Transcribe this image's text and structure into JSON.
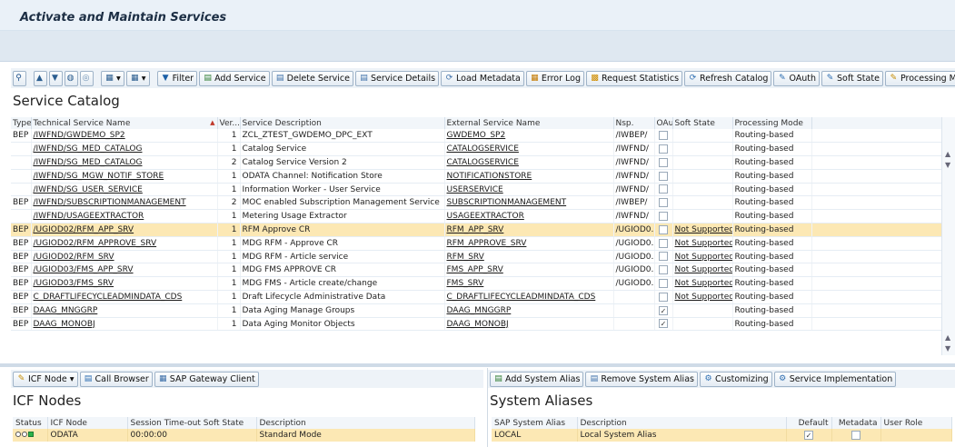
{
  "page": {
    "title": "Activate and Maintain Services"
  },
  "toolbar": {
    "filter": "Filter",
    "add_service": "Add Service",
    "delete_service": "Delete Service",
    "service_details": "Service Details",
    "load_metadata": "Load Metadata",
    "error_log": "Error Log",
    "request_statistics": "Request Statistics",
    "refresh_catalog": "Refresh Catalog",
    "oauth": "OAuth",
    "soft_state": "Soft State",
    "processing_mode": "Processing Mode"
  },
  "service_catalog": {
    "title": "Service Catalog",
    "columns": [
      "Type",
      "Technical Service Name",
      "Ver...",
      "Service Description",
      "External Service Name",
      "Nsp.",
      "OAut...",
      "Soft State",
      "Processing Mode"
    ],
    "rows": [
      {
        "type": "BEP",
        "tech": "/IWFND/GWDEMO_SP2",
        "ver": "1",
        "desc": "ZCL_ZTEST_GWDEMO_DPC_EXT",
        "ext": "GWDEMO_SP2",
        "nsp": "/IWBEP/",
        "oauth": false,
        "soft": "",
        "mode": "Routing-based",
        "selected": false
      },
      {
        "type": "",
        "tech": "/IWFND/SG_MED_CATALOG",
        "ver": "1",
        "desc": "Catalog Service",
        "ext": "CATALOGSERVICE",
        "nsp": "/IWFND/",
        "oauth": false,
        "soft": "",
        "mode": "Routing-based",
        "selected": false
      },
      {
        "type": "",
        "tech": "/IWFND/SG_MED_CATALOG",
        "ver": "2",
        "desc": "Catalog Service Version 2",
        "ext": "CATALOGSERVICE",
        "nsp": "/IWFND/",
        "oauth": false,
        "soft": "",
        "mode": "Routing-based",
        "selected": false
      },
      {
        "type": "",
        "tech": "/IWFND/SG_MGW_NOTIF_STORE",
        "ver": "1",
        "desc": "ODATA Channel: Notification Store",
        "ext": "NOTIFICATIONSTORE",
        "nsp": "/IWFND/",
        "oauth": false,
        "soft": "",
        "mode": "Routing-based",
        "selected": false
      },
      {
        "type": "",
        "tech": "/IWFND/SG_USER_SERVICE",
        "ver": "1",
        "desc": "Information Worker - User Service",
        "ext": "USERSERVICE",
        "nsp": "/IWFND/",
        "oauth": false,
        "soft": "",
        "mode": "Routing-based",
        "selected": false
      },
      {
        "type": "BEP",
        "tech": "/IWFND/SUBSCRIPTIONMANAGEMENT",
        "ver": "2",
        "desc": "MOC enabled Subscription Management Service",
        "ext": "SUBSCRIPTIONMANAGEMENT",
        "nsp": "/IWBEP/",
        "oauth": false,
        "soft": "",
        "mode": "Routing-based",
        "selected": false
      },
      {
        "type": "",
        "tech": "/IWFND/USAGEEXTRACTOR",
        "ver": "1",
        "desc": "Metering Usage Extractor",
        "ext": "USAGEEXTRACTOR",
        "nsp": "/IWFND/",
        "oauth": false,
        "soft": "",
        "mode": "Routing-based",
        "selected": false
      },
      {
        "type": "BEP",
        "tech": "/UGIOD02/RFM_APP_SRV",
        "ver": "1",
        "desc": "RFM Approve CR",
        "ext": "RFM_APP_SRV",
        "nsp": "/UGIOD0...",
        "oauth": false,
        "soft": "Not Supported",
        "mode": "Routing-based",
        "selected": true
      },
      {
        "type": "BEP",
        "tech": "/UGIOD02/RFM_APPROVE_SRV",
        "ver": "1",
        "desc": "MDG RFM - Approve CR",
        "ext": "RFM_APPROVE_SRV",
        "nsp": "/UGIOD0...",
        "oauth": false,
        "soft": "Not Supported",
        "mode": "Routing-based",
        "selected": false
      },
      {
        "type": "BEP",
        "tech": "/UGIOD02/RFM_SRV",
        "ver": "1",
        "desc": "MDG RFM - Article service",
        "ext": "RFM_SRV",
        "nsp": "/UGIOD0...",
        "oauth": false,
        "soft": "Not Supported",
        "mode": "Routing-based",
        "selected": false
      },
      {
        "type": "BEP",
        "tech": "/UGIOD03/FMS_APP_SRV",
        "ver": "1",
        "desc": "MDG FMS APPROVE CR",
        "ext": "FMS_APP_SRV",
        "nsp": "/UGIOD0...",
        "oauth": false,
        "soft": "Not Supported",
        "mode": "Routing-based",
        "selected": false
      },
      {
        "type": "BEP",
        "tech": "/UGIOD03/FMS_SRV",
        "ver": "1",
        "desc": "MDG FMS - Article create/change",
        "ext": "FMS_SRV",
        "nsp": "/UGIOD0...",
        "oauth": false,
        "soft": "Not Supported",
        "mode": "Routing-based",
        "selected": false
      },
      {
        "type": "BEP",
        "tech": "C_DRAFTLIFECYCLEADMINDATA_CDS",
        "ver": "1",
        "desc": "Draft Lifecycle Administrative Data",
        "ext": "C_DRAFTLIFECYCLEADMINDATA_CDS",
        "nsp": "",
        "oauth": false,
        "soft": "Not Supported",
        "mode": "Routing-based",
        "selected": false
      },
      {
        "type": "BEP",
        "tech": "DAAG_MNGGRP",
        "ver": "1",
        "desc": "Data Aging Manage Groups",
        "ext": "DAAG_MNGGRP",
        "nsp": "",
        "oauth": true,
        "soft": "",
        "mode": "Routing-based",
        "selected": false
      },
      {
        "type": "BEP",
        "tech": "DAAG_MONOBJ",
        "ver": "1",
        "desc": "Data Aging Monitor Objects",
        "ext": "DAAG_MONOBJ",
        "nsp": "",
        "oauth": true,
        "soft": "",
        "mode": "Routing-based",
        "selected": false
      }
    ]
  },
  "icf": {
    "toolbar": {
      "icf_node": "ICF Node",
      "call_browser": "Call Browser",
      "gateway_client": "SAP Gateway Client"
    },
    "title": "ICF Nodes",
    "columns": [
      "Status",
      "ICF Node",
      "Session Time-out Soft State",
      "Description"
    ],
    "row": {
      "node": "ODATA",
      "timeout": "00:00:00",
      "description": "Standard Mode"
    }
  },
  "aliases": {
    "toolbar": {
      "add_alias": "Add System Alias",
      "remove_alias": "Remove System Alias",
      "customizing": "Customizing",
      "service_impl": "Service Implementation"
    },
    "title": "System Aliases",
    "columns": [
      "SAP System Alias",
      "Description",
      "Default",
      "Metadata",
      "User Role"
    ],
    "row": {
      "alias": "LOCAL",
      "description": "Local System Alias",
      "default": true,
      "metadata": false,
      "role": ""
    }
  }
}
